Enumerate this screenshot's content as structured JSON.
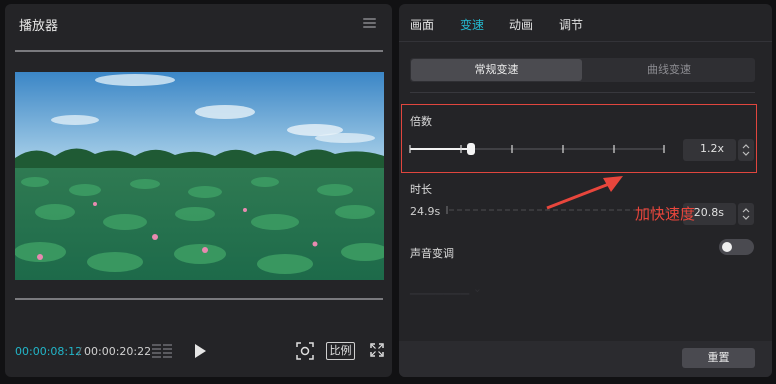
{
  "player": {
    "title": "播放器",
    "current_time": "00:00:08:12",
    "separator": "/",
    "total_time": "00:00:20:22",
    "ratio_label": "比例"
  },
  "props": {
    "tabs": [
      {
        "label": "画面"
      },
      {
        "label": "变速",
        "active": true
      },
      {
        "label": "动画"
      },
      {
        "label": "调节"
      }
    ],
    "mode_tabs": {
      "normal": "常规变速",
      "curve": "曲线变速"
    },
    "speed": {
      "label": "倍数",
      "value": "1.2x"
    },
    "duration": {
      "label": "时长",
      "original": "24.9s",
      "value": "20.8s"
    },
    "pitch": {
      "label": "声音变调",
      "enabled": false
    },
    "reset_label": "重置"
  },
  "annotation": {
    "text": "加快速度",
    "color": "#e8463c"
  },
  "colors": {
    "accent": "#25b9cf",
    "annotation": "#e8463c"
  }
}
